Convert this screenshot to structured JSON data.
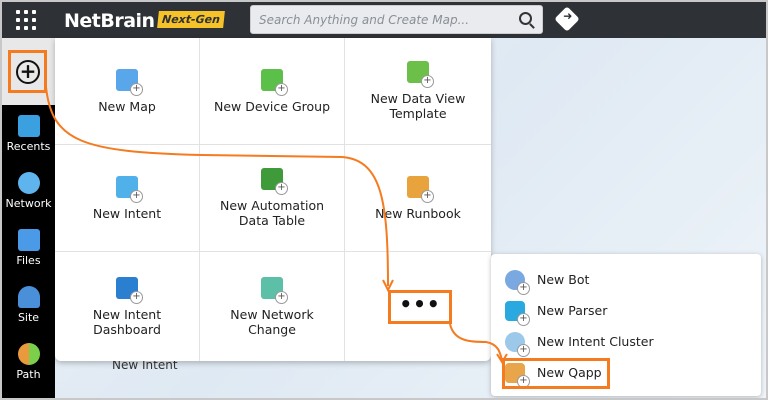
{
  "topbar": {
    "brand": "NetBrain",
    "badge": "Next-Gen",
    "search_placeholder": "Search Anything and Create Map..."
  },
  "sidebar": {
    "items": [
      {
        "label": "Recents",
        "color": "#3aa0e0"
      },
      {
        "label": "Network",
        "color": "#5fb4ee"
      },
      {
        "label": "Files",
        "color": "#4a9ae8"
      },
      {
        "label": "Site",
        "color": "#4a90d9"
      },
      {
        "label": "Path",
        "color": "#e89a3c"
      }
    ]
  },
  "panel": {
    "items": [
      {
        "label": "New Map",
        "color": "#5aa6ea"
      },
      {
        "label": "New Device Group",
        "color": "#5cbf4a"
      },
      {
        "label": "New Data View Template",
        "color": "#6cc04a"
      },
      {
        "label": "New Intent",
        "color": "#4fb0ea"
      },
      {
        "label": "New Automation Data Table",
        "color": "#3f9a3a"
      },
      {
        "label": "New Runbook",
        "color": "#e8a33c"
      },
      {
        "label": "New Intent Dashboard",
        "color": "#2a7fd0"
      },
      {
        "label": "New Network Change",
        "color": "#5cc0a8"
      }
    ],
    "more_label": "•••",
    "behind_label": "New Intent"
  },
  "submenu": {
    "items": [
      {
        "label": "New Bot",
        "color": "#7aa8e0"
      },
      {
        "label": "New Parser",
        "color": "#2aa8e0"
      },
      {
        "label": "New Intent Cluster",
        "color": "#9cc8ea"
      },
      {
        "label": "New Qapp",
        "color": "#e8a54a"
      }
    ]
  },
  "accent": "#f47b20"
}
